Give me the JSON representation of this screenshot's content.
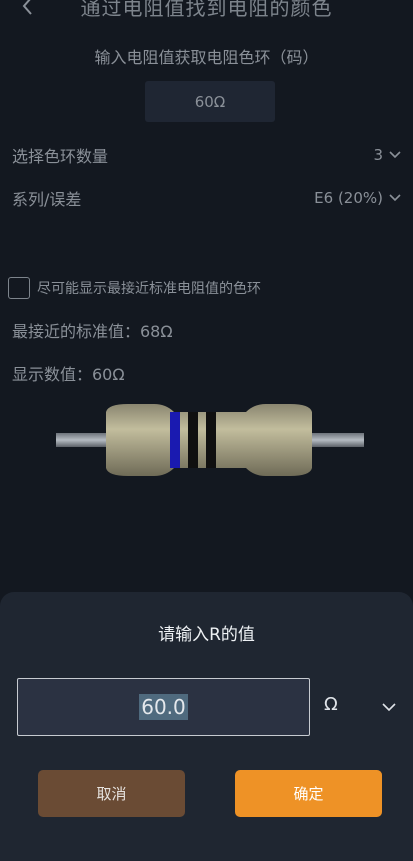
{
  "header": {
    "title": "通过电阻值找到电阻的颜色"
  },
  "subtitle": "输入电阻值获取电阻色环（码）",
  "value_display": "60Ω",
  "settings": {
    "band_count": {
      "label": "选择色环数量",
      "value": "3"
    },
    "series": {
      "label": "系列/误差",
      "value": "E6 (20%)"
    }
  },
  "checkbox": {
    "label": "尽可能显示最接近标准电阻值的色环",
    "checked": false
  },
  "info": {
    "nearest": "最接近的标准值：68Ω",
    "display": "显示数值：60Ω"
  },
  "resistor": {
    "bands": [
      "#1a1ab0",
      "#101010",
      "#101010"
    ],
    "body_color": "#b8b394"
  },
  "dialog": {
    "title": "请输入R的值",
    "input_value": "60.0",
    "unit": "Ω",
    "cancel_label": "取消",
    "confirm_label": "确定"
  },
  "icons": [
    "back-icon",
    "chevron-down-icon"
  ]
}
